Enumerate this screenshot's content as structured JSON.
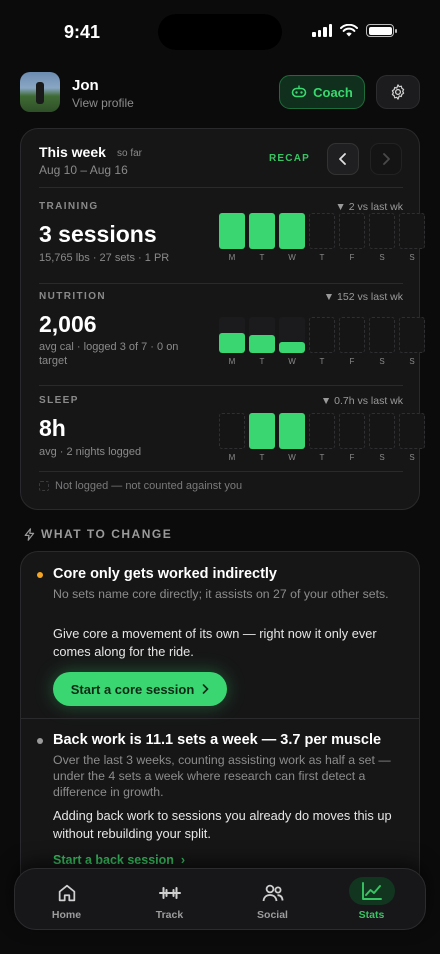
{
  "status": {
    "time": "9:41"
  },
  "colors": {
    "accent": "#3ad671",
    "background": "#0b0b0c",
    "card": "#161617"
  },
  "profile": {
    "name": "Jon",
    "subtitle": "View profile"
  },
  "header": {
    "coach_label": "Coach",
    "coach_icon": "coach-robot-icon",
    "settings_icon": "gear-icon"
  },
  "week": {
    "title": "This week",
    "so_far": "so far",
    "range": "Aug 10 – Aug 16",
    "recap": "RECAP"
  },
  "day_labels": [
    "M",
    "T",
    "W",
    "T",
    "F",
    "S",
    "S"
  ],
  "training": {
    "label": "TRAINING",
    "delta": "▼ 2 vs last wk",
    "value": "3 sessions",
    "sub": "15,765 lbs · 27 sets · 1 PR",
    "levels": [
      1,
      1,
      1,
      0,
      0,
      0,
      0
    ]
  },
  "nutrition": {
    "label": "NUTRITION",
    "delta": "▼ 152 vs last wk",
    "value": "2,006",
    "sub": "avg cal · logged 3 of 7 · 0 on target",
    "levels": [
      0.55,
      0.5,
      0.3,
      0,
      0,
      0,
      0
    ]
  },
  "sleep": {
    "label": "SLEEP",
    "delta": "▼ 0.7h vs last wk",
    "value": "8h",
    "sub": "avg · 2 nights logged",
    "levels": [
      0,
      1,
      1,
      0,
      0,
      0,
      0
    ]
  },
  "legend": "Not logged — not counted against you",
  "what_to_change": {
    "heading": "WHAT TO CHANGE",
    "item1": {
      "title": "Core only gets worked indirectly",
      "body": "No sets name core directly; it assists on 27 of your other sets.",
      "text": "Give core a movement of its own — right now it only ever comes along for the ride.",
      "cta": "Start a core session",
      "dot_color": "#f5a524"
    },
    "item2": {
      "title": "Back work is 11.1 sets a week — 3.7 per muscle",
      "body": "Over the last 3 weeks, counting assisting work as half a set — under the 4 sets a week where research can first detect a difference in growth.",
      "text": "Adding back work to sessions you already do moves this up without rebuilding your split.",
      "cta": "Start a back session",
      "dot_color": "#9a9a9a"
    }
  },
  "tabs": [
    {
      "label": "Home",
      "icon": "home-icon"
    },
    {
      "label": "Track",
      "icon": "dumbbell-icon"
    },
    {
      "label": "Social",
      "icon": "people-icon"
    },
    {
      "label": "Stats",
      "icon": "chart-icon",
      "active": true
    }
  ]
}
